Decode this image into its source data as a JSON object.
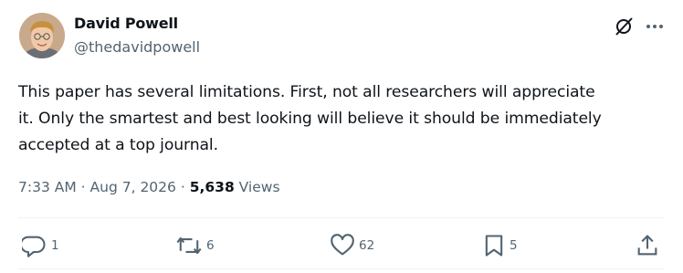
{
  "author": {
    "name": "David Powell",
    "handle": "@thedavidpowell",
    "avatar_icon": "profile-photo"
  },
  "header_icons": [
    "grok-icon",
    "more-icon"
  ],
  "tweet": {
    "text": "This paper has several limitations.  First, not all researchers will appreciate\nit.  Only the smartest and best looking will believe it should be immediately\naccepted at a top journal."
  },
  "meta": {
    "time": "7:33 AM",
    "separator": "·",
    "date": "Aug 7, 2026",
    "views_count": "5,638",
    "views_label": "Views"
  },
  "actions": {
    "replies": "1",
    "reposts": "6",
    "likes": "62",
    "bookmarks": "5"
  },
  "colors": {
    "text": "#0f1419",
    "secondary": "#536471",
    "divider": "#eff3f4"
  }
}
